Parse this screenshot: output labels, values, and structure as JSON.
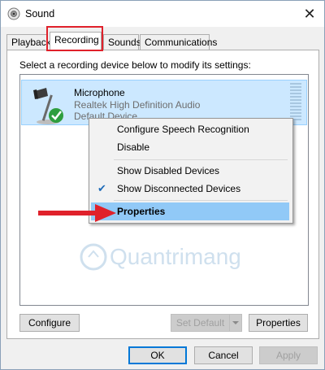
{
  "window": {
    "title": "Sound",
    "close_glyph": "✕"
  },
  "tabs": [
    {
      "label": "Playback"
    },
    {
      "label": "Recording",
      "active": true
    },
    {
      "label": "Sounds"
    },
    {
      "label": "Communications"
    }
  ],
  "recording": {
    "instruction": "Select a recording device below to modify its settings:",
    "device": {
      "name": "Microphone",
      "driver": "Realtek High Definition Audio",
      "state": "Default Device",
      "icon": "microphone-icon",
      "status_icon": "check-badge-icon"
    }
  },
  "context_menu": {
    "items": [
      {
        "label": "Configure Speech Recognition"
      },
      {
        "label": "Disable"
      },
      {
        "label": "Show Disabled Devices"
      },
      {
        "label": "Show Disconnected Devices",
        "checked": true
      },
      {
        "label": "Properties",
        "highlighted": true
      }
    ]
  },
  "buttons": {
    "configure": "Configure",
    "set_default": "Set Default",
    "properties": "Properties",
    "ok": "OK",
    "cancel": "Cancel",
    "apply": "Apply"
  },
  "watermark": {
    "text": "Quantrimang"
  },
  "colors": {
    "selection": "#cce8ff",
    "menu_highlight": "#91c9f7",
    "annotation_red": "#e0212b",
    "check_green": "#2e9e3e"
  }
}
